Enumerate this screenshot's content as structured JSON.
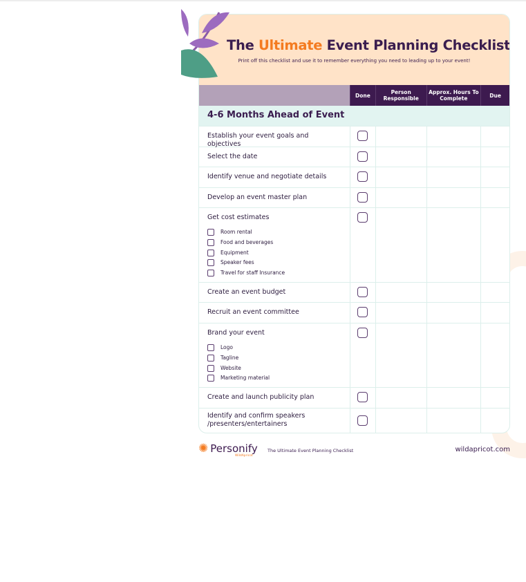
{
  "header": {
    "title_pre": "The ",
    "title_highlight": "Ultimate",
    "title_post": " Event  Planning Checklist",
    "subtitle": "Print off this checklist and use it to remember everything you need to leading up to your event!"
  },
  "columns": [
    "Done",
    "Person Responsible",
    "Approx. Hours To Complete",
    "Due"
  ],
  "section": "4-6 Months Ahead of Event",
  "tasks": [
    {
      "label": "Establish your event goals and objectives"
    },
    {
      "label": "Select the date"
    },
    {
      "label": "Identify venue and negotiate details"
    },
    {
      "label": "Develop an event master plan"
    },
    {
      "label": "Get cost estimates",
      "subs": [
        "Room rental",
        "Food and beverages",
        "Equipment",
        "Speaker fees",
        "Travel for staff Insurance"
      ]
    },
    {
      "label": "Create an event budget"
    },
    {
      "label": "Recruit an event committee"
    },
    {
      "label": "Brand your event",
      "subs": [
        "Logo",
        "Tagline",
        "Website",
        "Marketing material"
      ]
    },
    {
      "label": "Create and launch publicity plan"
    },
    {
      "label": "Identify and confirm speakers /presenters/entertainers"
    }
  ],
  "footer": {
    "brand": "Personify",
    "brand_sub": "WildApricot",
    "doc_title": "The Ultimate Event  Planning Checklist",
    "url": "wildapricot.com"
  },
  "colors": {
    "accent": "#f47b20",
    "primary": "#3d1a4f",
    "hero": "#ffe3c8",
    "section": "#e2f4f1"
  }
}
